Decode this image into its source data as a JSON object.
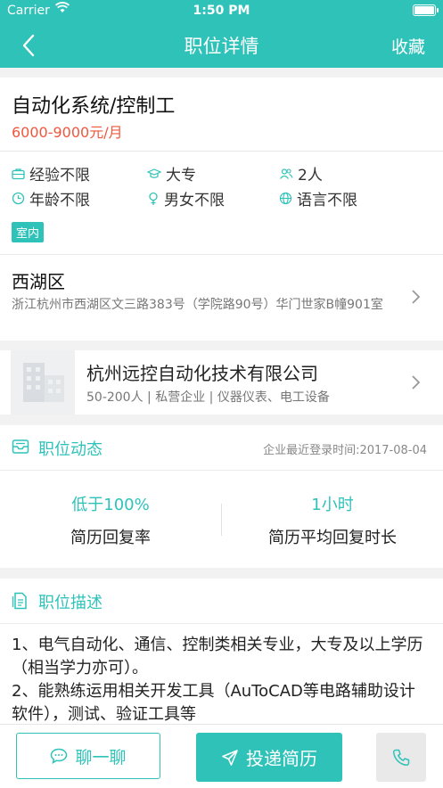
{
  "status_bar": {
    "carrier": "Carrier",
    "time": "1:50 PM"
  },
  "nav": {
    "title": "职位详情",
    "favorite_label": "收藏",
    "back_icon": "chevron-left-icon"
  },
  "job": {
    "title": "自动化系统/控制工",
    "salary": "6000-9000元/月",
    "requirements": [
      {
        "icon": "briefcase-icon",
        "text": "经验不限"
      },
      {
        "icon": "graduation-cap-icon",
        "text": "大专"
      },
      {
        "icon": "people-icon",
        "text": "2人"
      },
      {
        "icon": "clock-icon",
        "text": "年龄不限"
      },
      {
        "icon": "gender-icon",
        "text": "男女不限"
      },
      {
        "icon": "globe-icon",
        "text": "语言不限"
      }
    ],
    "tag": "室内"
  },
  "address": {
    "district": "西湖区",
    "detail": "浙江杭州市西湖区文三路383号（学院路90号）华门世家B幢901室"
  },
  "company": {
    "name": "杭州远控自动化技术有限公司",
    "info": "50-200人 | 私营企业 | 仪器仪表、电工设备"
  },
  "dynamics": {
    "title": "职位动态",
    "login_time": "企业最近登录时间:2017-08-04",
    "stats": [
      {
        "value": "低于100%",
        "label": "简历回复率"
      },
      {
        "value": "1小时",
        "label": "简历平均回复时长"
      }
    ]
  },
  "description": {
    "title": "职位描述",
    "lines": [
      "1、电气自动化、通信、控制类相关专业，大专及以上学历（相当学力亦可）。",
      "2、能熟练运用相关开发工具（AuToCAD等电路辅助设计软件），测试、验证工具等"
    ]
  },
  "bottom_bar": {
    "chat_label": "聊一聊",
    "apply_label": "投递简历"
  },
  "colors": {
    "accent": "#2fc2b9",
    "salary": "#f0563d"
  }
}
